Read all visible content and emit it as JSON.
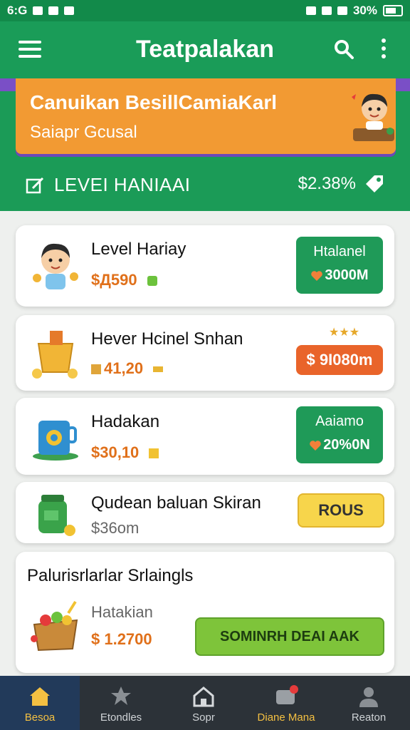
{
  "status_bar": {
    "left": "6:G",
    "right": "30%"
  },
  "app_bar": {
    "title": "Teatpalakan"
  },
  "banner": {
    "title": "Canuikan BesillCamiaKarl",
    "subtitle": "Saiapr Gcusal"
  },
  "level": {
    "label": "LEVEI HANIAAI",
    "value": "$2.38%"
  },
  "cards": [
    {
      "title": "Level Hariay",
      "price": "$Д590",
      "button_top": "Htalanel",
      "button_bottom": "3000M"
    },
    {
      "title": "Hever Hcinel Snhan",
      "price": "41,20",
      "button": "$ 9I080m"
    },
    {
      "title": "Hadakan",
      "price": "$30,10",
      "button_top": "Aaiamo",
      "button_bottom": "20%0N"
    },
    {
      "title": "Qudean baluan Skiran",
      "price": "$36om",
      "button": "ROUS"
    }
  ],
  "promo": {
    "title": "Palurisrlarlar Srlaingls",
    "item_title": "Hatakian",
    "price": "$ 1.2700",
    "button": "SOMINRH DEAI AAK"
  },
  "bottom_nav": [
    {
      "label": "Besoa",
      "icon": "home-icon"
    },
    {
      "label": "Etondles",
      "icon": "leaf-icon"
    },
    {
      "label": "Sopr",
      "icon": "store-icon"
    },
    {
      "label": "Diane Mana",
      "icon": "message-icon"
    },
    {
      "label": "Reaton",
      "icon": "profile-icon"
    }
  ],
  "colors": {
    "primary_green": "#1a9c58",
    "banner_orange": "#f29a33",
    "accent_purple": "#7a4fc6",
    "nav_bg": "#2c3238",
    "nav_active": "#f4c042"
  }
}
